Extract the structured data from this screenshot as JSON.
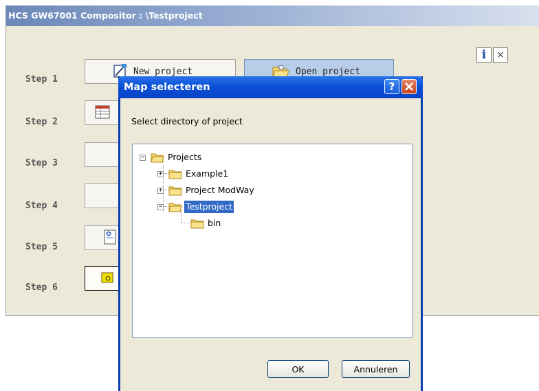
{
  "app": {
    "title": "HCS GW67001 Compositor : \\Testproject",
    "steps": [
      {
        "label": "Step 1",
        "button": "New project"
      },
      {
        "label": "Step 2",
        "button": ""
      },
      {
        "label": "Step 3",
        "button": ""
      },
      {
        "label": "Step 4",
        "button": ""
      },
      {
        "label": "Step 5",
        "button": ""
      },
      {
        "label": "Step 6",
        "button": ""
      }
    ],
    "open_project_label": "Open project",
    "info_icon": "info-icon",
    "close_icon": "close-icon"
  },
  "dialog": {
    "title": "Map selecteren",
    "help_glyph": "?",
    "prompt": "Select directory of project",
    "tree": {
      "root": "Projects",
      "children": [
        "Example1",
        "Project ModWay",
        "Testproject"
      ],
      "selected": "Testproject",
      "subfolder": "bin"
    },
    "ok_label": "OK",
    "cancel_label": "Annuleren"
  },
  "colors": {
    "app_title_bar": "#6b88b8",
    "dialog_title_bar": "#0a4fd6",
    "selection": "#316ac5",
    "folder": "#f5d36b"
  }
}
